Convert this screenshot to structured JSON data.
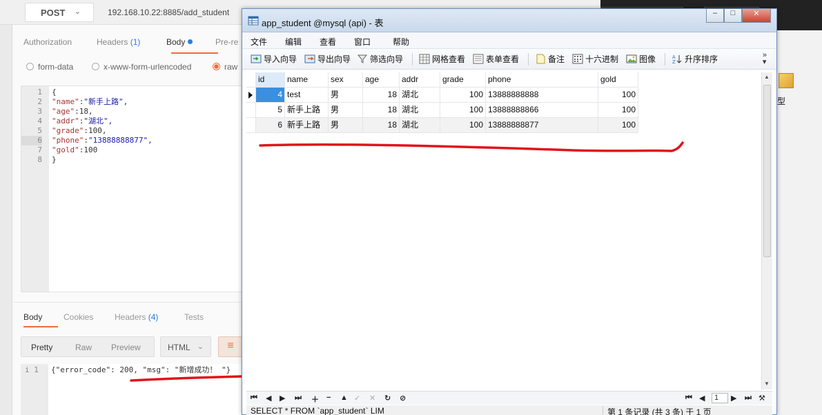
{
  "postman": {
    "method": "POST",
    "url": "192.168.10.22:8885/add_student",
    "request_tabs": [
      {
        "label": "Authorization",
        "count": ""
      },
      {
        "label": "Headers",
        "count": "(1)"
      },
      {
        "label": "Body",
        "count": ""
      },
      {
        "label": "Pre-re",
        "count": ""
      }
    ],
    "body_modes": [
      "form-data",
      "x-www-form-urlencoded",
      "raw"
    ],
    "body_lines": [
      {
        "n": "1",
        "text": "{"
      },
      {
        "n": "2",
        "key": "\"name\"",
        "val": "\"新手上路\","
      },
      {
        "n": "3",
        "key": "\"age\"",
        "val": "18,"
      },
      {
        "n": "4",
        "key": "\"addr\"",
        "val": "\"湖北\","
      },
      {
        "n": "5",
        "key": "\"grade\"",
        "val": "100,"
      },
      {
        "n": "6",
        "key": "\"phone\"",
        "val": "\"13888888877\","
      },
      {
        "n": "7",
        "key": "\"gold\"",
        "val": "100"
      },
      {
        "n": "8",
        "text": "}"
      }
    ],
    "response_tabs": [
      {
        "label": "Body",
        "count": ""
      },
      {
        "label": "Cookies",
        "count": ""
      },
      {
        "label": "Headers",
        "count": "(4)"
      },
      {
        "label": "Tests",
        "count": ""
      }
    ],
    "view_modes": [
      "Pretty",
      "Raw",
      "Preview"
    ],
    "format": "HTML",
    "response_line_no": "1",
    "response_text": "{\"error_code\": 200, \"msg\": \"新增成功！ \"}"
  },
  "navicat": {
    "title": "app_student @mysql (api) - 表",
    "menus": [
      "文件",
      "编辑",
      "查看",
      "窗口",
      "帮助"
    ],
    "tools": [
      "导入向导",
      "导出向导",
      "筛选向导",
      "网格查看",
      "表单查看",
      "备注",
      "十六进制",
      "图像",
      "升序排序"
    ],
    "columns": [
      "id",
      "name",
      "sex",
      "age",
      "addr",
      "grade",
      "phone",
      "gold"
    ],
    "rows": [
      [
        "4",
        "test",
        "男",
        "18",
        "湖北",
        "100",
        "13888888888",
        "100"
      ],
      [
        "5",
        "新手上路",
        "男",
        "18",
        "湖北",
        "100",
        "13888888866",
        "100"
      ],
      [
        "6",
        "新手上路",
        "男",
        "18",
        "湖北",
        "100",
        "13888888877",
        "100"
      ]
    ],
    "page_number": "1",
    "status_sql": "SELECT * FROM `app_student` LIM",
    "status_records": "第 1 条记录 (共 3 条) 于 1 页"
  },
  "background": {
    "side_label": "型"
  },
  "colors": {
    "postman_accent": "#f26b3a",
    "postman_link": "#2a7be4",
    "annotation_red": "#e0141b",
    "grid_selected": "#3a8fe0"
  }
}
